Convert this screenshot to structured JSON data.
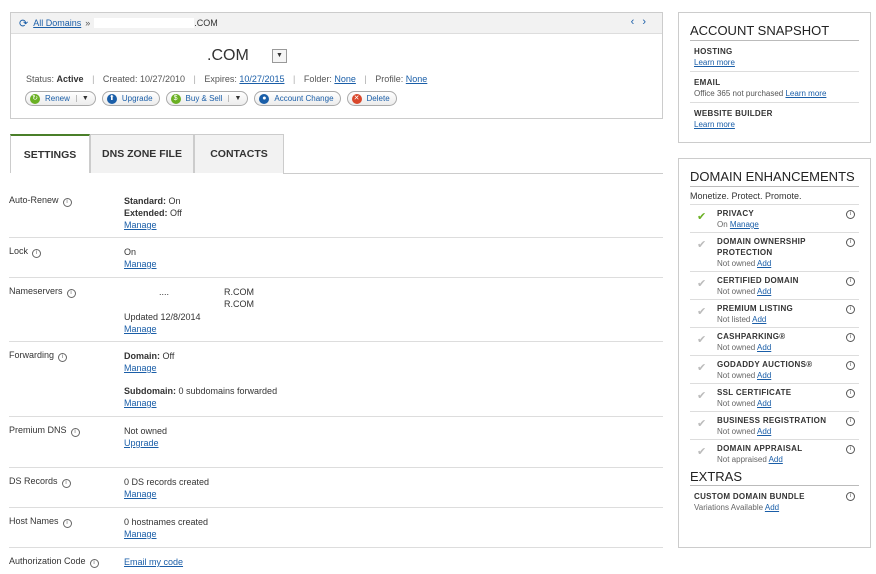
{
  "breadcrumb": {
    "link": "All Domains",
    "separator": "»",
    "tail": ".COM"
  },
  "domain": {
    "title": ".COM",
    "dropdown_icon": "caret-down"
  },
  "status": {
    "status_label": "Status:",
    "status_value": "Active",
    "created_label": "Created:",
    "created_value": "10/27/2010",
    "expires_label": "Expires:",
    "expires_value": "10/27/2015",
    "folder_label": "Folder:",
    "folder_value": "None",
    "profile_label": "Profile:",
    "profile_value": "None"
  },
  "actions": {
    "renew": "Renew",
    "upgrade": "Upgrade",
    "buysell": "Buy & Sell",
    "account_change": "Account Change",
    "delete": "Delete"
  },
  "tabs": [
    "SETTINGS",
    "DNS ZONE FILE",
    "CONTACTS"
  ],
  "settings": {
    "autorenew": {
      "label": "Auto-Renew",
      "standard_label": "Standard:",
      "standard_value": "On",
      "extended_label": "Extended:",
      "extended_value": "Off",
      "link": "Manage"
    },
    "lock": {
      "label": "Lock",
      "value": "On",
      "link": "Manage"
    },
    "nameservers": {
      "label": "Nameservers",
      "ns1_prefix": "....",
      "ns1": "R.COM",
      "ns2": "R.COM",
      "updated": "Updated 12/8/2014",
      "link": "Manage"
    },
    "forwarding": {
      "label": "Forwarding",
      "domain_label": "Domain:",
      "domain_value": "Off",
      "link1": "Manage",
      "subdomain_label": "Subdomain:",
      "subdomain_value": "0 subdomains forwarded",
      "link2": "Manage"
    },
    "premium_dns": {
      "label": "Premium DNS",
      "value": "Not owned",
      "link": "Upgrade"
    },
    "ds_records": {
      "label": "DS Records",
      "value": "0 DS records created",
      "link": "Manage"
    },
    "host_names": {
      "label": "Host Names",
      "value": "0 hostnames created",
      "link": "Manage"
    },
    "auth_code": {
      "label": "Authorization Code",
      "link": "Email my code"
    }
  },
  "snapshot": {
    "title": "ACCOUNT SNAPSHOT",
    "hosting": {
      "head": "HOSTING",
      "link": "Learn more"
    },
    "email": {
      "head": "EMAIL",
      "text": "Office 365 not purchased",
      "link": "Learn more"
    },
    "builder": {
      "head": "WEBSITE BUILDER",
      "link": "Learn more"
    }
  },
  "enhancements": {
    "title": "DOMAIN ENHANCEMENTS",
    "subtitle": "Monetize. Protect. Promote.",
    "items": [
      {
        "name": "PRIVACY",
        "status": "On",
        "link": "Manage",
        "active": true
      },
      {
        "name": "DOMAIN OWNERSHIP PROTECTION",
        "status": "Not owned",
        "link": "Add",
        "active": false
      },
      {
        "name": "CERTIFIED DOMAIN",
        "status": "Not owned",
        "link": "Add",
        "active": false
      },
      {
        "name": "PREMIUM LISTING",
        "status": "Not listed",
        "link": "Add",
        "active": false
      },
      {
        "name": "CASHPARKING®",
        "status": "Not owned",
        "link": "Add",
        "active": false
      },
      {
        "name": "GODADDY AUCTIONS®",
        "status": "Not owned",
        "link": "Add",
        "active": false
      },
      {
        "name": "SSL CERTIFICATE",
        "status": "Not owned",
        "link": "Add",
        "active": false
      },
      {
        "name": "BUSINESS REGISTRATION",
        "status": "Not owned",
        "link": "Add",
        "active": false
      },
      {
        "name": "DOMAIN APPRAISAL",
        "status": "Not appraised",
        "link": "Add",
        "active": false
      }
    ]
  },
  "extras": {
    "title": "EXTRAS",
    "item": {
      "name": "CUSTOM DOMAIN BUNDLE",
      "status": "Variations Available",
      "link": "Add"
    }
  },
  "colors": {
    "link": "#1a5ea8",
    "tab_accent": "#4a7f29",
    "check_active": "#6ab023",
    "check_inactive": "#bbbbbb"
  }
}
